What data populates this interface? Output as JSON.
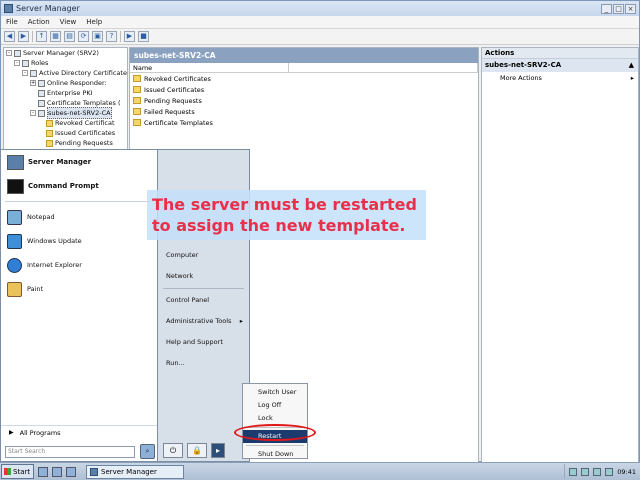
{
  "window": {
    "title": "Server Manager",
    "menu": [
      "File",
      "Action",
      "View",
      "Help"
    ]
  },
  "tree": {
    "items": [
      {
        "label": "Server Manager (SRV2)",
        "level": 0,
        "exp": "-"
      },
      {
        "label": "Roles",
        "level": 1,
        "exp": "-"
      },
      {
        "label": "Active Directory Certificate",
        "level": 2,
        "exp": "-"
      },
      {
        "label": "Online Responder:",
        "level": 3,
        "exp": "+"
      },
      {
        "label": "Enterprise PKI",
        "level": 3,
        "exp": ""
      },
      {
        "label": "Certificate Templates (",
        "level": 3,
        "exp": ""
      },
      {
        "label": "subes-net-SRV2-CA",
        "level": 3,
        "exp": "-",
        "selected": true
      },
      {
        "label": "Revoked Certificat",
        "level": 4,
        "exp": ""
      },
      {
        "label": "Issued Certificates",
        "level": 4,
        "exp": ""
      },
      {
        "label": "Pending Requests",
        "level": 4,
        "exp": ""
      }
    ]
  },
  "center": {
    "title": "subes-net-SRV2-CA",
    "column": "Name",
    "items": [
      "Revoked Certificates",
      "Issued Certificates",
      "Pending Requests",
      "Failed Requests",
      "Certificate Templates"
    ]
  },
  "actions": {
    "header": "Actions",
    "section": "subes-net-SRV2-CA",
    "more": "More Actions"
  },
  "startmenu": {
    "pinned": [
      "Server Manager",
      "Command Prompt"
    ],
    "recent": [
      "Notepad",
      "Windows Update",
      "Internet Explorer",
      "Paint"
    ],
    "all_programs": "All Programs",
    "search_placeholder": "Start Search",
    "right": [
      "Computer",
      "Network",
      "Control Panel",
      "Administrative Tools",
      "Help and Support",
      "Run..."
    ],
    "power_submenu": [
      "Switch User",
      "Log Off",
      "Lock",
      "Restart",
      "Shut Down"
    ]
  },
  "callout": "The server must be restarted to assign the new template.",
  "taskbar": {
    "start": "Start",
    "task": "Server Manager",
    "clock": "09:41"
  }
}
